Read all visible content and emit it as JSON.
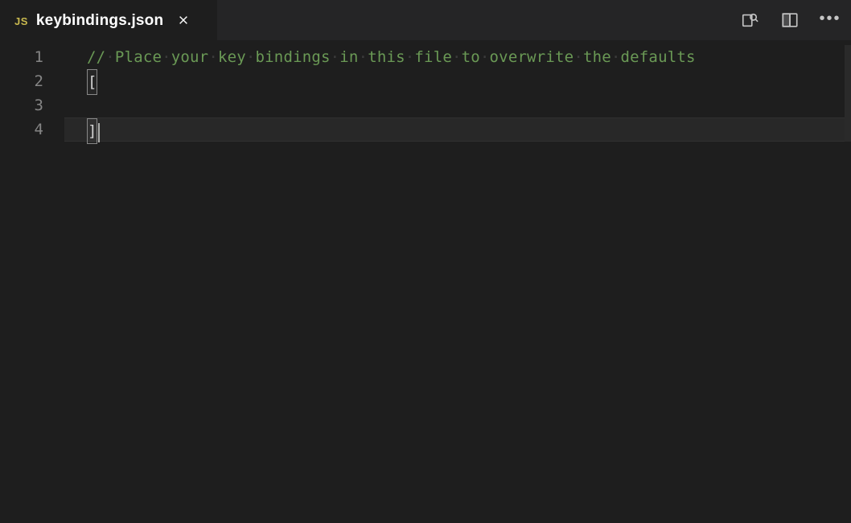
{
  "tab": {
    "language_badge": "JS",
    "title": "keybindings.json"
  },
  "editor": {
    "line_numbers": [
      "1",
      "2",
      "3",
      "4"
    ],
    "comment_tokens": [
      "//",
      "Place",
      "your",
      "key",
      "bindings",
      "in",
      "this",
      "file",
      "to",
      "overwrite",
      "the",
      "defaults"
    ],
    "open_bracket": "[",
    "close_bracket": "]",
    "current_line_index": 3
  },
  "actions": {
    "search_changes": "open-changes",
    "split_editor": "split-editor",
    "more": "more-actions"
  }
}
